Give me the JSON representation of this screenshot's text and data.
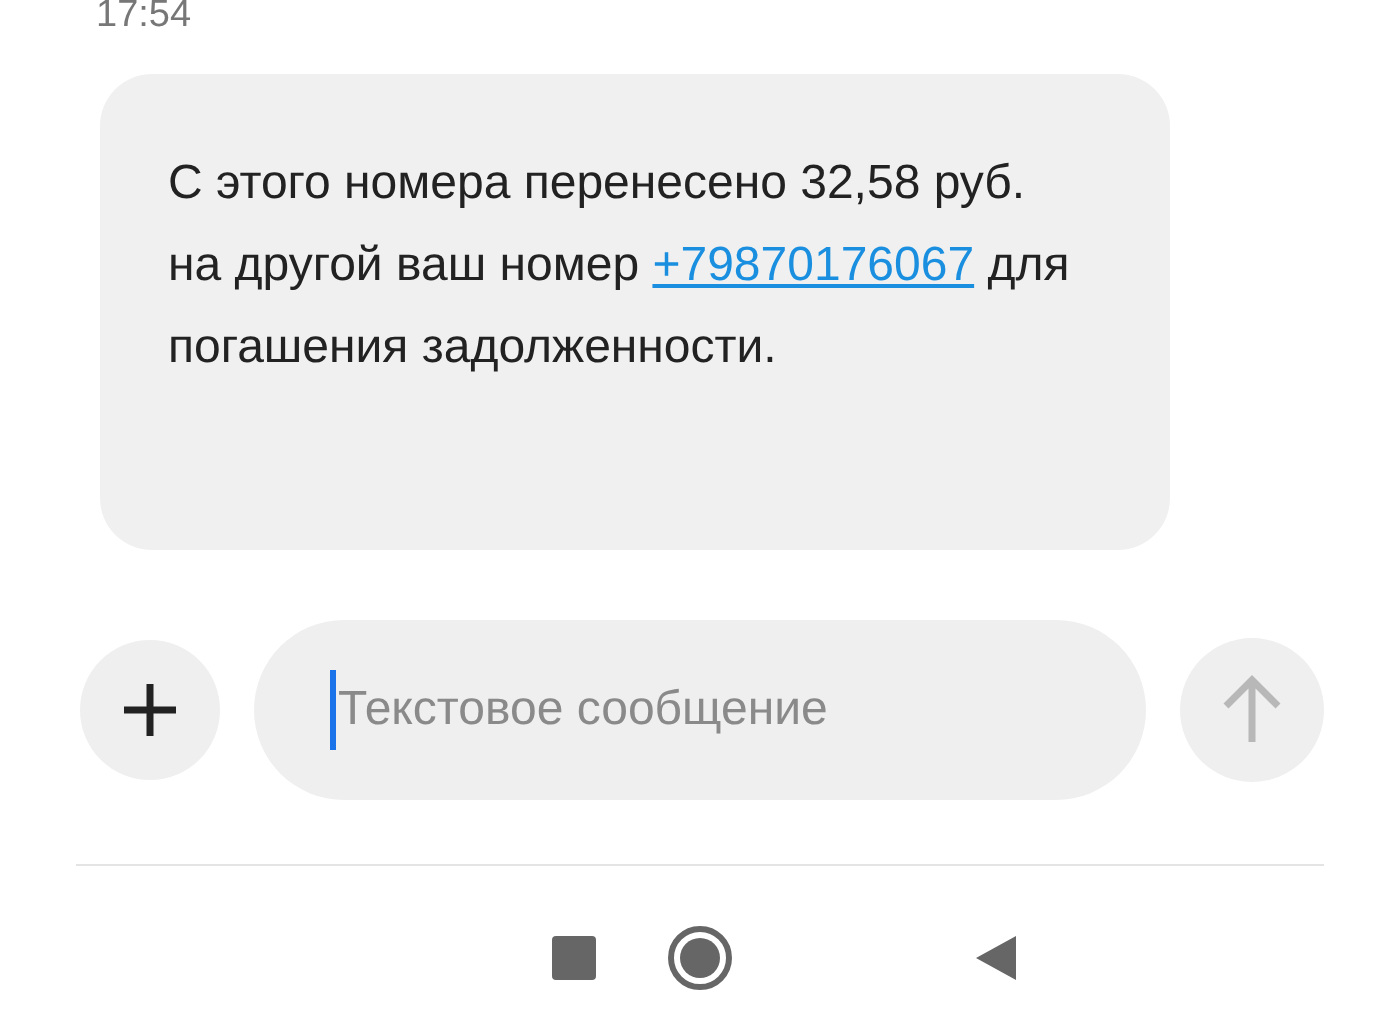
{
  "time": "17:54",
  "message": {
    "segments": [
      {
        "kind": "text",
        "text": "С этого номера перенесено 32,58 руб. на другой ваш номер "
      },
      {
        "kind": "link",
        "text": "+79870176067"
      },
      {
        "kind": "text",
        "text": " для погашения задолженности."
      }
    ]
  },
  "composer": {
    "placeholder": "Текстовое сообщение",
    "send_disabled": true
  }
}
